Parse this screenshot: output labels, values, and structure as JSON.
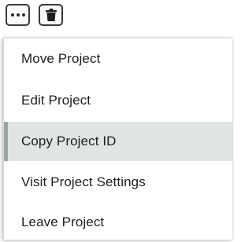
{
  "toolbar": {
    "more_icon": "more-horizontal-icon",
    "delete_icon": "trash-icon"
  },
  "menu": {
    "items": [
      {
        "label": "Move Project"
      },
      {
        "label": "Edit Project"
      },
      {
        "label": "Copy Project ID",
        "highlighted": true
      },
      {
        "label": "Visit Project Settings"
      },
      {
        "label": "Leave Project"
      }
    ],
    "highlight_color": "#dfe5e3",
    "highlight_bar_color": "#9ba6a3"
  }
}
